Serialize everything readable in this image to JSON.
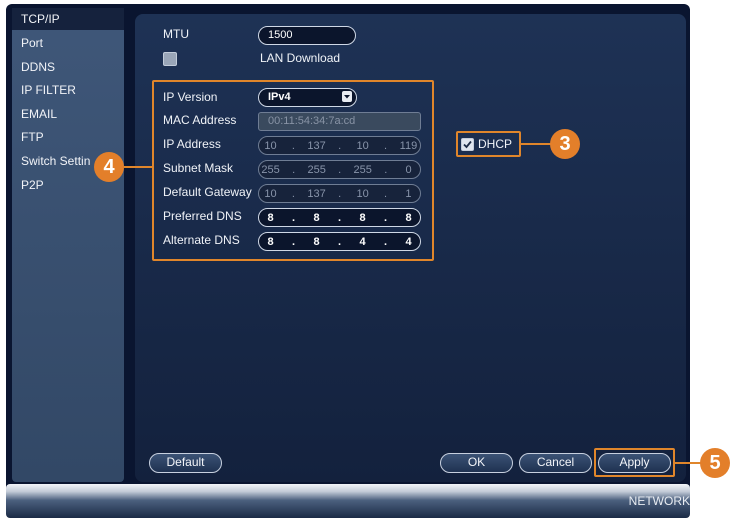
{
  "sidebar": {
    "items": [
      {
        "label": "TCP/IP",
        "active": true
      },
      {
        "label": "Port"
      },
      {
        "label": "DDNS"
      },
      {
        "label": "IP FILTER"
      },
      {
        "label": "EMAIL"
      },
      {
        "label": "FTP"
      },
      {
        "label": "Switch Settin"
      },
      {
        "label": "P2P"
      }
    ]
  },
  "form": {
    "mtu_label": "MTU",
    "mtu_value": "1500",
    "lan_download_label": "LAN Download",
    "lan_download_checked": false,
    "ip_version_label": "IP Version",
    "ip_version_value": "IPv4",
    "mac_label": "MAC Address",
    "mac_value": "00:11:54:34:7a:cd",
    "ip_address_label": "IP Address",
    "ip_address": [
      "10",
      "137",
      "10",
      "119"
    ],
    "subnet_label": "Subnet Mask",
    "subnet": [
      "255",
      "255",
      "255",
      "0"
    ],
    "gateway_label": "Default Gateway",
    "gateway": [
      "10",
      "137",
      "10",
      "1"
    ],
    "pref_dns_label": "Preferred DNS",
    "pref_dns": [
      "8",
      "8",
      "8",
      "8"
    ],
    "alt_dns_label": "Alternate DNS",
    "alt_dns": [
      "8",
      "8",
      "4",
      "4"
    ],
    "dhcp_label": "DHCP",
    "dhcp_checked": true,
    "dot": "."
  },
  "buttons": {
    "default": "Default",
    "ok": "OK",
    "cancel": "Cancel",
    "apply": "Apply"
  },
  "callouts": {
    "three": "3",
    "four": "4",
    "five": "5"
  },
  "footer_title": "NETWORK",
  "icons": {
    "dropdown": "chevron-down-icon",
    "check": "check-icon"
  },
  "colors": {
    "accent": "#e0862b",
    "panel": "#1a2d4e",
    "background": "#0a1530"
  }
}
